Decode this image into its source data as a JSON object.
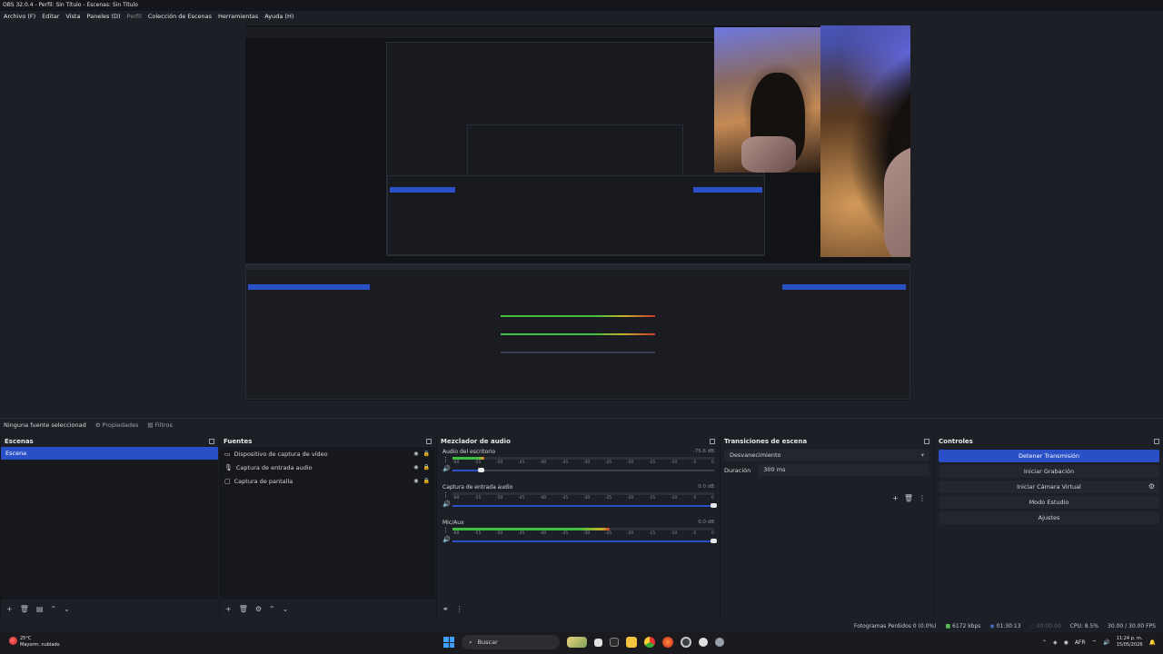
{
  "window": {
    "title": "OBS 32.0.4 - Perfil: Sin Título - Escenas: Sin Título"
  },
  "menu": [
    {
      "label": "Archivo (F)",
      "dim": false
    },
    {
      "label": "Editar",
      "dim": false
    },
    {
      "label": "Vista",
      "dim": false
    },
    {
      "label": "Paneles (D)",
      "dim": false
    },
    {
      "label": "Perfil",
      "dim": true
    },
    {
      "label": "Colección de Escenas",
      "dim": false
    },
    {
      "label": "Herramientas",
      "dim": false
    },
    {
      "label": "Ayuda (H)",
      "dim": false
    }
  ],
  "context_bar": {
    "source_status": "Ninguna fuente seleccionad",
    "properties_label": "Propiedades",
    "filters_label": "Filtros"
  },
  "scenes": {
    "title": "Escenas",
    "items": [
      {
        "label": "Escena",
        "active": true
      }
    ]
  },
  "sources": {
    "title": "Fuentes",
    "items": [
      {
        "label": "Dispositivo de captura de vídeo",
        "icon": "camera-icon"
      },
      {
        "label": "Captura de entrada audio",
        "icon": "microphone-icon"
      },
      {
        "label": "Captura de pantalla",
        "icon": "monitor-icon"
      }
    ]
  },
  "mixer": {
    "title": "Mezclador de audio",
    "scale": [
      "-60",
      "-55",
      "-50",
      "-45",
      "-40",
      "-35",
      "-30",
      "-25",
      "-20",
      "-15",
      "-10",
      "-5",
      "0"
    ],
    "channels": [
      {
        "name": "Audio del escritorio",
        "db": "-75.6 dB",
        "level": 0.12,
        "volume": 0.11
      },
      {
        "name": "Captura de entrada audio",
        "db": "0.0 dB",
        "level": 0.0,
        "volume": 1.0
      },
      {
        "name": "Mic/Aux",
        "db": "0.0 dB",
        "level": 0.6,
        "volume": 1.0
      }
    ]
  },
  "transitions": {
    "title": "Transiciones de escena",
    "selected": "Desvanecimiento",
    "duration_label": "Duración",
    "duration_value": "300 ms"
  },
  "controls": {
    "title": "Controles",
    "buttons": [
      {
        "label": "Detener Transmisión",
        "primary": true
      },
      {
        "label": "Iniciar Grabación",
        "primary": false
      },
      {
        "label": "Iniciar Cámara Virtual",
        "primary": false
      },
      {
        "label": "Modo Estudio",
        "primary": false
      },
      {
        "label": "Ajustes",
        "primary": false
      }
    ]
  },
  "status": {
    "dropped_frames": "Fotogramas Perdidos 0 (0.0%)",
    "bitrate": "6172 kbps",
    "stream_time": "01:30:13",
    "record_time": "00:00:00",
    "cpu": "CPU: 8.5%",
    "fps": "30.00 / 30.00 FPS"
  },
  "taskbar": {
    "weather_temp": "25°C",
    "weather_desc": "Mayorm. nublado",
    "search_placeholder": "Buscar",
    "language": "AFR",
    "time": "11:24 p. m.",
    "date": "15/05/2026"
  },
  "colors": {
    "accent": "#2a50c8",
    "meter_green": "#3fbf3f",
    "meter_yellow": "#c8b12a",
    "meter_red": "#c83a2a"
  }
}
